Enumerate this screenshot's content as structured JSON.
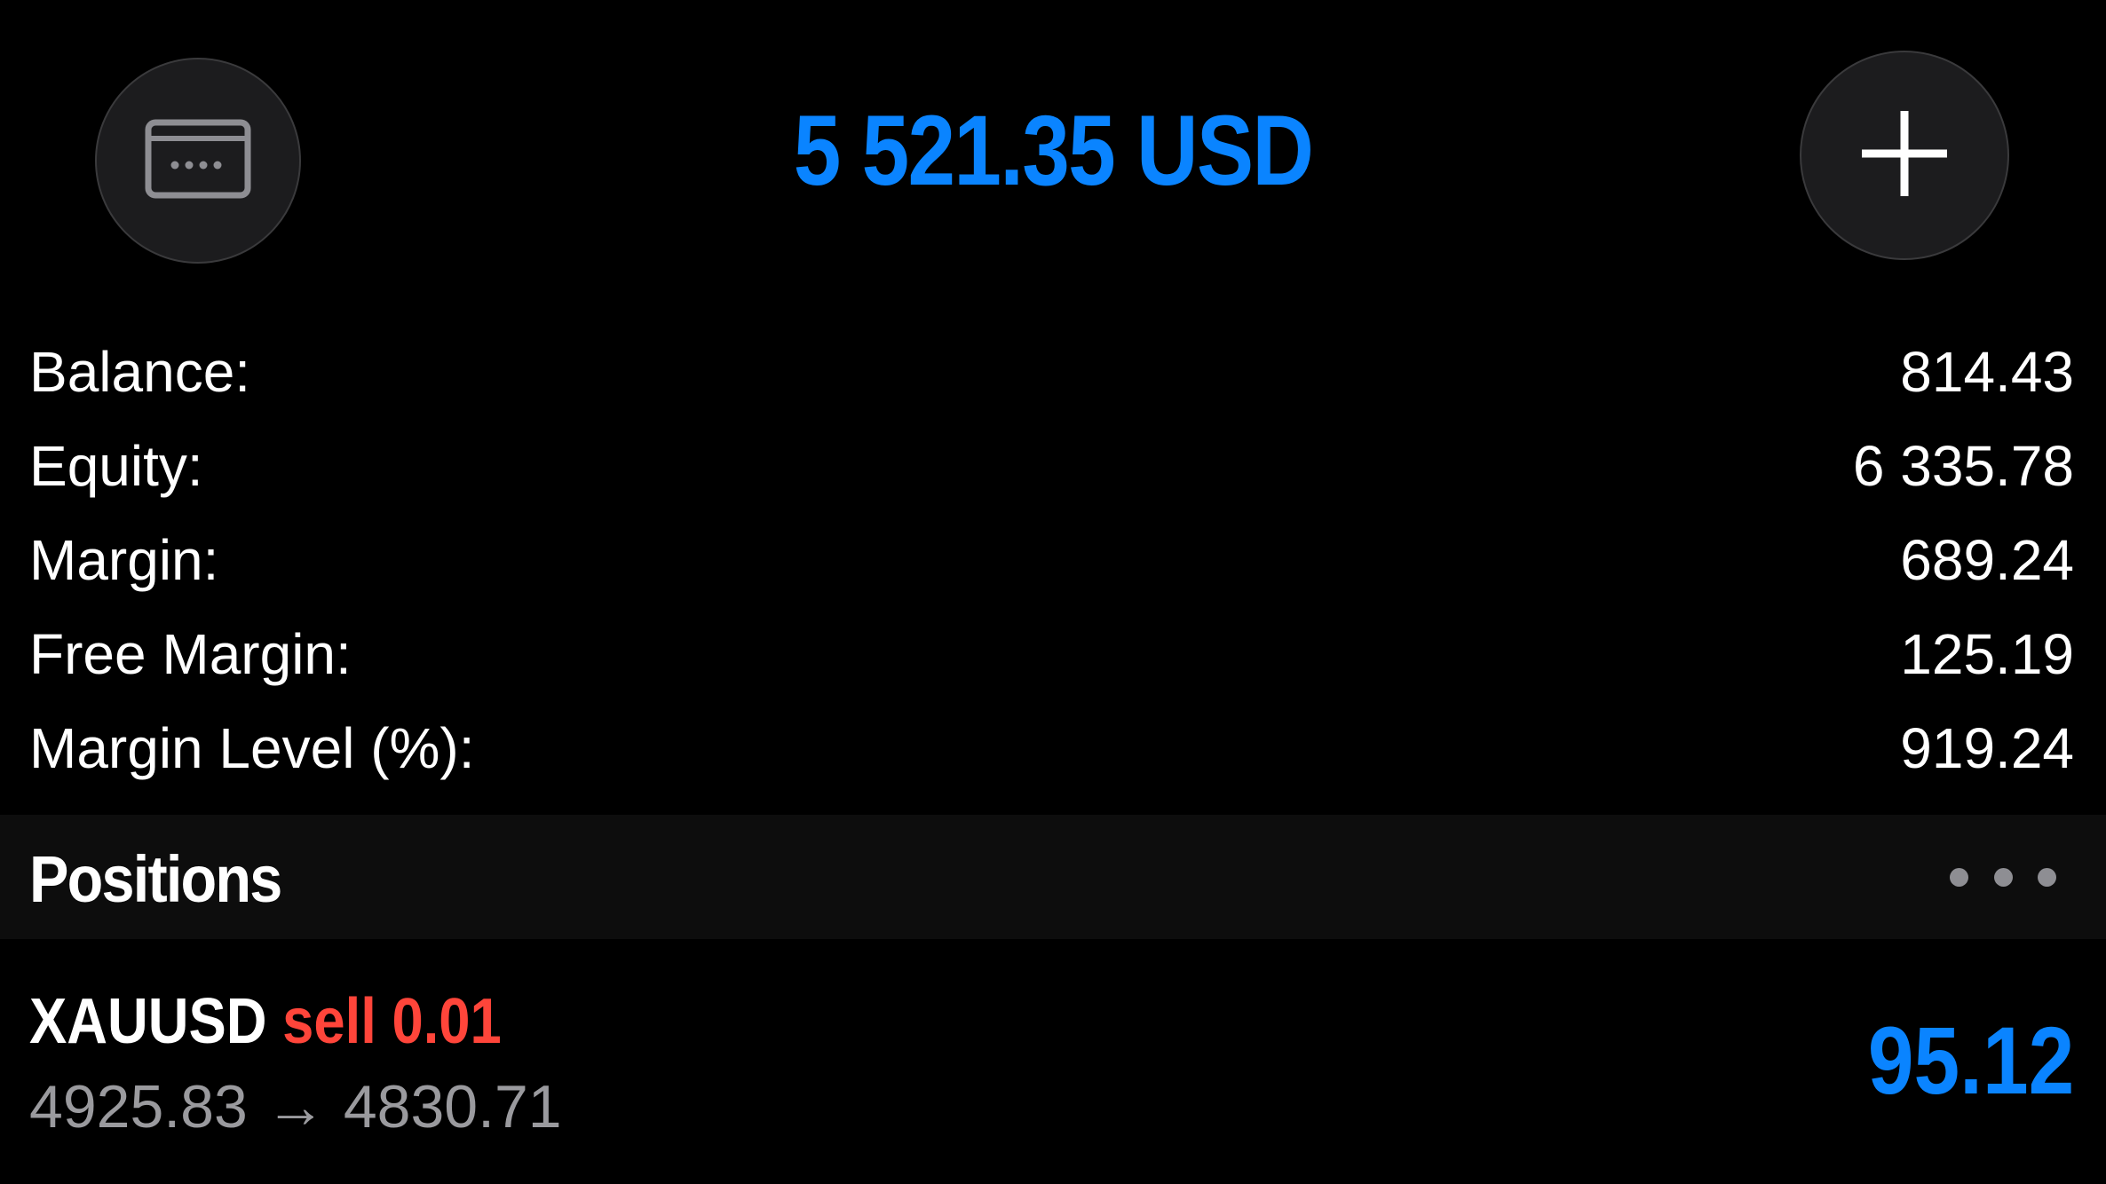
{
  "header": {
    "total_equity": "5 521.35 USD",
    "deposit_icon": "credit-card-icon",
    "add_icon": "plus-icon"
  },
  "summary": [
    {
      "label": "Balance:",
      "value": "814.43"
    },
    {
      "label": "Equity:",
      "value": "6 335.78"
    },
    {
      "label": "Margin:",
      "value": "689.24"
    },
    {
      "label": "Free Margin:",
      "value": "125.19"
    },
    {
      "label": "Margin Level (%):",
      "value": "919.24"
    }
  ],
  "positions": {
    "title": "Positions",
    "more_icon": "more-horizontal-icon",
    "items": [
      {
        "symbol": "XAUUSD",
        "side": "sell",
        "volume": "0.01",
        "open_price": "4925.83",
        "arrow": "→",
        "current_price": "4830.71",
        "profit": "95.12"
      }
    ]
  },
  "colors": {
    "background": "#000000",
    "accent_blue": "#0a84ff",
    "sell_red": "#ff453a",
    "secondary_text": "#9a9a9e",
    "section_bg": "#0d0d0d",
    "button_bg": "#1c1c1e"
  }
}
